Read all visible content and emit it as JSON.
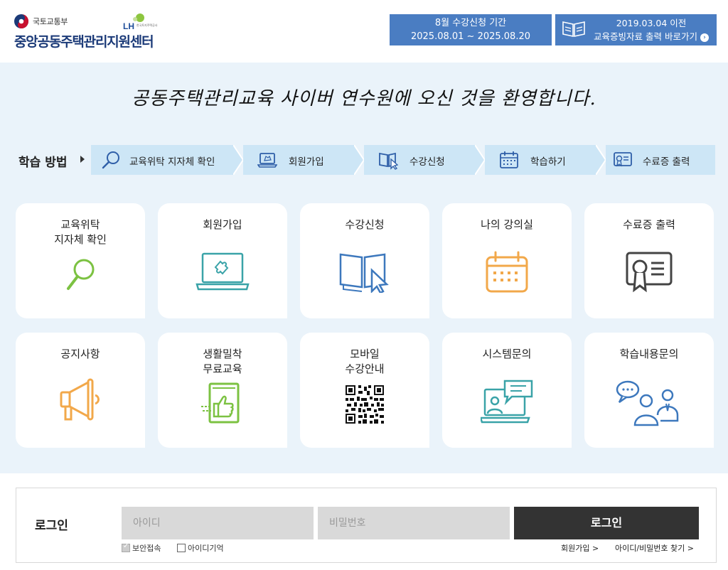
{
  "header": {
    "ministry": "국토교통부",
    "lh_name": "LH",
    "lh_subtitle": "한국토지주택공사",
    "center_name": "중앙공동주택관리지원센터",
    "banner1": {
      "line1": "8월 수강신청 기간",
      "line2": "2025.08.01 ~ 2025.08.20"
    },
    "banner2": {
      "line1": "2019.03.04 이전",
      "line2": "교육증빙자료 출력 바로가기"
    }
  },
  "welcome": "공동주택관리교육 사이버 연수원에 오신 것을 환영합니다.",
  "steps": {
    "title": "학습 방법",
    "items": [
      {
        "label": "교육위탁 지자체 확인",
        "icon": "search-icon"
      },
      {
        "label": "회원가입",
        "icon": "laptop-icon"
      },
      {
        "label": "수강신청",
        "icon": "book-cursor-icon"
      },
      {
        "label": "학습하기",
        "icon": "calendar-icon"
      },
      {
        "label": "수료증 출력",
        "icon": "certificate-icon"
      }
    ]
  },
  "cards": {
    "row1": [
      {
        "title": "교육위탁\n지자체 확인",
        "icon": "search-icon",
        "color": "#7cc242"
      },
      {
        "title": "회원가입",
        "icon": "laptop-puzzle-icon",
        "color": "#3aa3a8"
      },
      {
        "title": "수강신청",
        "icon": "book-cursor-icon",
        "color": "#3d78bd"
      },
      {
        "title": "나의 강의실",
        "icon": "calendar-icon",
        "color": "#f2a84a"
      },
      {
        "title": "수료증 출력",
        "icon": "certificate-icon",
        "color": "#444444"
      }
    ],
    "row2": [
      {
        "title": "공지사항",
        "icon": "megaphone-icon",
        "color": "#f2a84a"
      },
      {
        "title": "생활밀착\n무료교육",
        "icon": "thumbs-up-book-icon",
        "color": "#7cc242"
      },
      {
        "title": "모바일\n수강안내",
        "icon": "qr-code-icon",
        "color": "#111111"
      },
      {
        "title": "시스템문의",
        "icon": "computer-chat-icon",
        "color": "#3aa3a8"
      },
      {
        "title": "학습내용문의",
        "icon": "people-chat-icon",
        "color": "#3d78bd"
      }
    ]
  },
  "login": {
    "title": "로그인",
    "id_placeholder": "아이디",
    "pw_placeholder": "비밀번호",
    "button": "로그인",
    "secure_label": "보안접속",
    "remember_label": "아이디기억",
    "join_link": "회원가입 >",
    "find_link": "아이디/비밀번호 찾기 >"
  },
  "colors": {
    "banner": "#4a7dc2",
    "main_bg": "#eaf3fa",
    "step_bg": "#cde6f6",
    "login_button": "#333333"
  }
}
